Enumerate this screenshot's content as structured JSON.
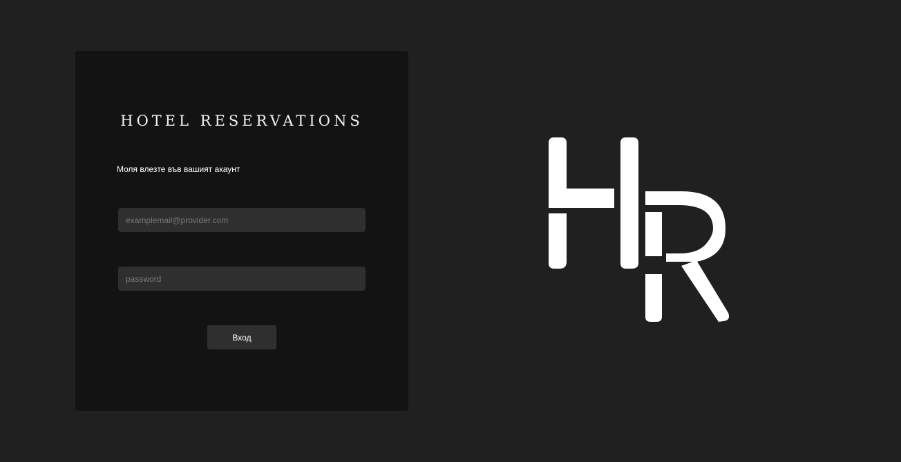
{
  "login": {
    "title": "HOTEL RESERVATIONS",
    "subtitle": "Моля влезте във вашият акаунт",
    "email_placeholder": "examplemail@provider.com",
    "password_placeholder": "password",
    "submit_label": "Вход"
  },
  "logo": {
    "letters": "HR",
    "name": "hotel-reservations-logo"
  },
  "colors": {
    "page_background": "#202020",
    "card_background": "#131313",
    "field_background": "#2f2f2f",
    "logo": "#ffffff"
  }
}
